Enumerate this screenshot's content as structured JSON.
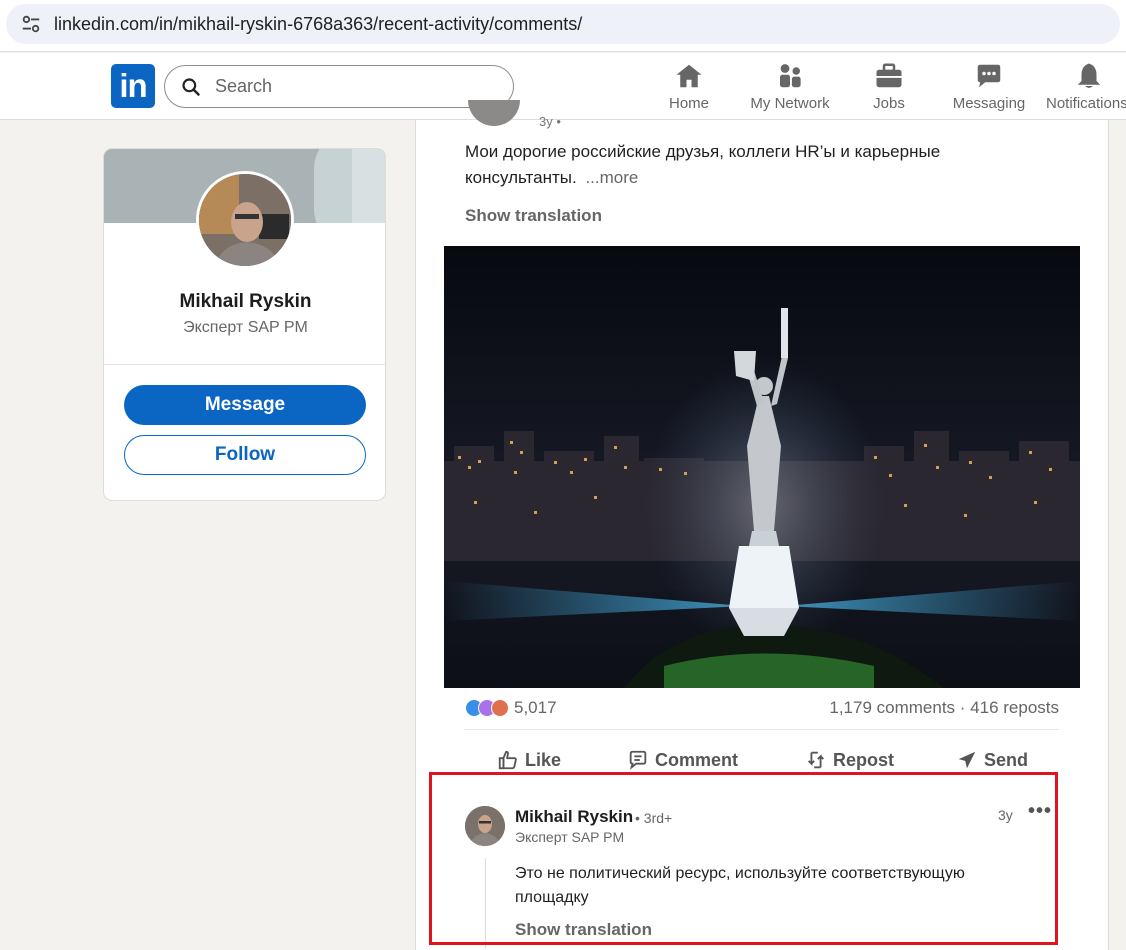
{
  "browser": {
    "url": "linkedin.com/in/mikhail-ryskin-6768a363/recent-activity/comments/",
    "site_info_icon": "tune-icon"
  },
  "nav": {
    "logo_text": "in",
    "search_placeholder": "Search",
    "items": [
      {
        "label": "Home",
        "icon": "home-icon"
      },
      {
        "label": "My Network",
        "icon": "network-icon"
      },
      {
        "label": "Jobs",
        "icon": "briefcase-icon"
      },
      {
        "label": "Messaging",
        "icon": "messaging-icon"
      },
      {
        "label": "Notifications",
        "icon": "bell-icon"
      }
    ]
  },
  "profile": {
    "name": "Mikhail Ryskin",
    "headline": "Эксперт SAP PM",
    "message_label": "Message",
    "follow_label": "Follow"
  },
  "post": {
    "time_cut": "3y •",
    "text": "Мои дорогие российские друзья, коллеги HR’ы и карьерные консультанты.",
    "more_label": "...more",
    "show_translation": "Show translation",
    "reaction_count": "5,017",
    "comments_reposts": "1,179 comments · 416 reposts",
    "actions": {
      "like": "Like",
      "comment": "Comment",
      "repost": "Repost",
      "send": "Send"
    }
  },
  "comment": {
    "author": "Mikhail Ryskin",
    "degree": "• 3rd+",
    "headline": "Эксперт SAP PM",
    "time": "3y",
    "more_label": "•••",
    "text": "Это не политический ресурс, используйте соответствующую площадку",
    "show_translation": "Show translation"
  },
  "colors": {
    "brand": "#0a66c2",
    "highlight": "#e0141e",
    "background": "#f4f2ee"
  }
}
